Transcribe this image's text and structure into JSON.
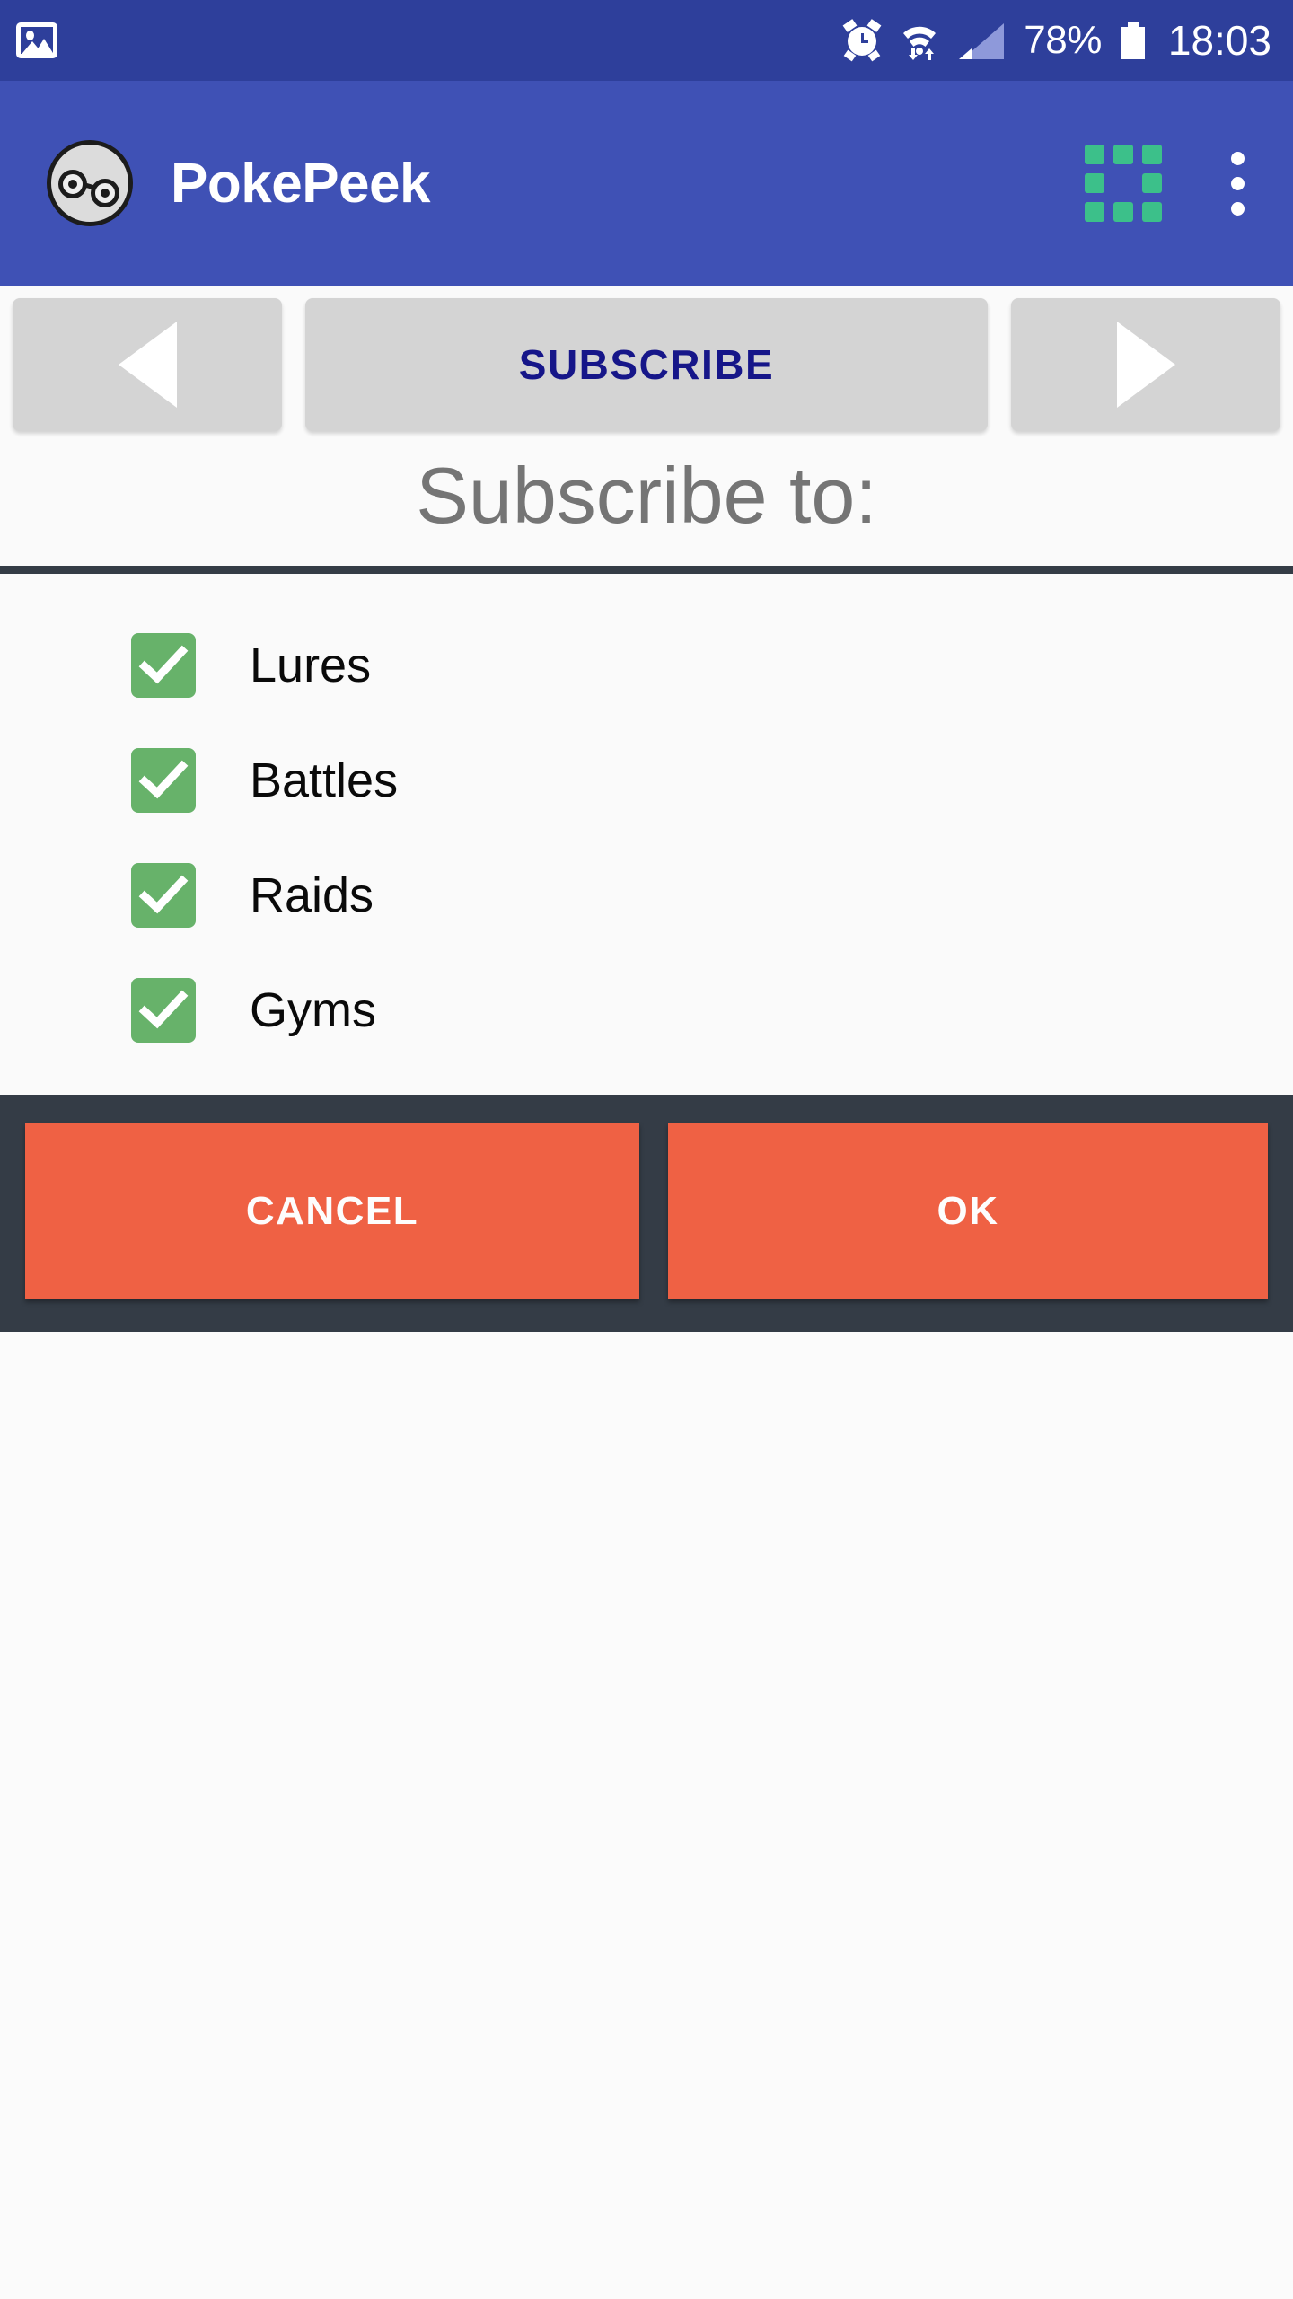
{
  "status_bar": {
    "background": "#2e3f9b",
    "notification_icon": "photo-icon",
    "alarm_icon": "alarm-icon",
    "wifi_icon": "wifi-icon",
    "signal_icon": "signal-icon",
    "battery_percent": "78%",
    "battery_icon": "battery-icon",
    "clock": "18:03"
  },
  "app_bar": {
    "background": "#3f51b5",
    "logo_icon": "pokepeek-face-logo",
    "title": "PokePeek",
    "grid_icon": "grid-apps-icon",
    "grid_icon_color": "#3cc08a",
    "overflow_icon": "more-vertical-icon"
  },
  "nav_row": {
    "prev_icon": "arrow-left-icon",
    "subscribe_label": "SUBSCRIBE",
    "subscribe_text_color": "#161689",
    "next_icon": "arrow-right-icon"
  },
  "content": {
    "heading": "Subscribe to:",
    "heading_color": "#757575",
    "divider_color": "#343c46",
    "checkbox_color": "#67b26a",
    "items": [
      {
        "label": "Lures",
        "checked": true
      },
      {
        "label": "Battles",
        "checked": true
      },
      {
        "label": "Raids",
        "checked": true
      },
      {
        "label": "Gyms",
        "checked": true
      }
    ]
  },
  "action_bar": {
    "background": "#343c46",
    "button_color": "#ef6144",
    "cancel_label": "CANCEL",
    "ok_label": "OK"
  }
}
